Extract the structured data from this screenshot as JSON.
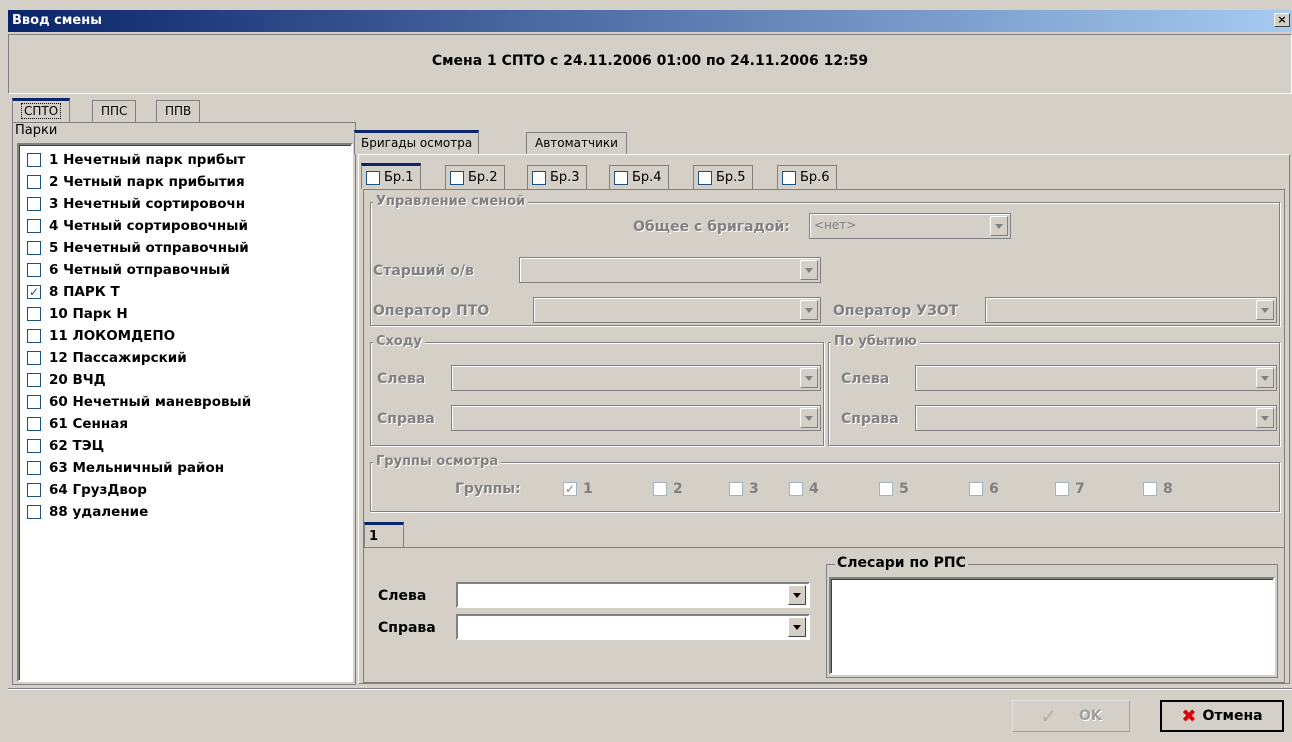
{
  "window": {
    "title": "Ввод смены",
    "close_glyph": "×"
  },
  "header": {
    "shift_title": "Смена 1 СПТО с 24.11.2006 01:00 по 24.11.2006 12:59"
  },
  "main_tabs": [
    "СПТО",
    "ППС",
    "ППВ"
  ],
  "parks": {
    "title": "Парки",
    "items": [
      {
        "label": "1 Нечетный парк прибыт",
        "checked": false
      },
      {
        "label": "2 Четный парк прибытия",
        "checked": false
      },
      {
        "label": "3 Нечетный сортировочн",
        "checked": false
      },
      {
        "label": "4 Четный сортировочный",
        "checked": false
      },
      {
        "label": "5 Нечетный отправочный",
        "checked": false
      },
      {
        "label": "6 Четный  отправочный",
        "checked": false
      },
      {
        "label": "8 ПАРК Т",
        "checked": true
      },
      {
        "label": "10 Парк Н",
        "checked": false
      },
      {
        "label": "11 ЛОКОМДЕПО",
        "checked": false
      },
      {
        "label": "12 Пассажирский",
        "checked": false
      },
      {
        "label": "20 ВЧД",
        "checked": false
      },
      {
        "label": "60 Нечетный маневровый",
        "checked": false
      },
      {
        "label": "61 Сенная",
        "checked": false
      },
      {
        "label": "62 ТЭЦ",
        "checked": false
      },
      {
        "label": "63 Мельничный район",
        "checked": false
      },
      {
        "label": "64 ГрузДвор",
        "checked": false
      },
      {
        "label": "88 удаление",
        "checked": false
      }
    ]
  },
  "right_tabs": [
    "Бригады осмотра",
    "Автоматчики"
  ],
  "brigade_tabs": [
    "Бр.1",
    "Бр.2",
    "Бр.3",
    "Бр.4",
    "Бр.5",
    "Бр.6"
  ],
  "shift_mgmt": {
    "title": "Управление сменой",
    "common_label": "Общее с бригадой:",
    "common_value": "<нет>",
    "senior_label": "Старший о/в",
    "operator_pto_label": "Оператор ПТО",
    "operator_uzot_label": "Оператор УЗОТ"
  },
  "shodu": {
    "title": "Сходу",
    "left": "Слева",
    "right": "Справа"
  },
  "pubytiyu": {
    "title": "По убытию",
    "left": "Слева",
    "right": "Справа"
  },
  "inspection_groups": {
    "title": "Группы осмотра",
    "label": "Группы:",
    "items": [
      {
        "label": "1",
        "checked": true
      },
      {
        "label": "2",
        "checked": false
      },
      {
        "label": "3",
        "checked": false
      },
      {
        "label": "4",
        "checked": false
      },
      {
        "label": "5",
        "checked": false
      },
      {
        "label": "6",
        "checked": false
      },
      {
        "label": "7",
        "checked": false
      },
      {
        "label": "8",
        "checked": false
      }
    ]
  },
  "group_tab": {
    "label": "1"
  },
  "group_panel": {
    "left_label": "Слева",
    "right_label": "Справа",
    "locksmiths_title": "Слесари по РПС"
  },
  "buttons": {
    "ok": "OK",
    "cancel": "Отмена"
  }
}
